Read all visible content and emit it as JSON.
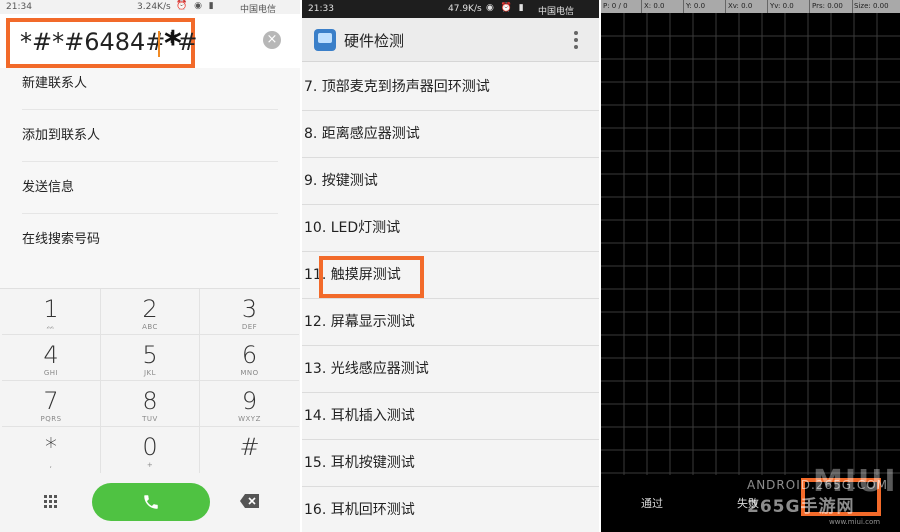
{
  "dialer": {
    "status": {
      "time": "21:34",
      "speed": "3.24K/s",
      "icons": "⏰ ◉ ▮",
      "carrier": "中国电信"
    },
    "number": "*#*#6484#*#",
    "star": "*",
    "menu": [
      "新建联系人",
      "添加到联系人",
      "发送信息",
      "在线搜索号码"
    ],
    "keys": [
      {
        "digit": "1",
        "letters": "ᨐ"
      },
      {
        "digit": "2",
        "letters": "ABC"
      },
      {
        "digit": "3",
        "letters": "DEF"
      },
      {
        "digit": "4",
        "letters": "GHI"
      },
      {
        "digit": "5",
        "letters": "JKL"
      },
      {
        "digit": "6",
        "letters": "MNO"
      },
      {
        "digit": "7",
        "letters": "PQRS"
      },
      {
        "digit": "8",
        "letters": "TUV"
      },
      {
        "digit": "9",
        "letters": "WXYZ"
      },
      {
        "digit": "*",
        "letters": ","
      },
      {
        "digit": "0",
        "letters": "+"
      },
      {
        "digit": "#",
        "letters": ""
      }
    ]
  },
  "hwtest": {
    "status": {
      "time": "21:33",
      "speed": "47.9K/s",
      "icons": "◉ ⏰ ▮",
      "carrier": "中国电信"
    },
    "title": "硬件检测",
    "items": [
      "7. 顶部麦克到扬声器回环测试",
      "8. 距离感应器测试",
      "9. 按键测试",
      "10. LED灯测试",
      "11. 触摸屏测试",
      "12. 屏幕显示测试",
      "13. 光线感应器测试",
      "14. 耳机插入测试",
      "15. 耳机按键测试",
      "16. 耳机回环测试"
    ]
  },
  "touchtest": {
    "fields": [
      "P: 0 / 0",
      "X: 0.0",
      "Y: 0.0",
      "Xv: 0.0",
      "Yv: 0.0",
      "Prs: 0.00",
      "Size: 0.00"
    ],
    "pass_label": "通过",
    "fail_label": "失败",
    "watermark": {
      "main": "ANDROID.265G.COM",
      "big": "MIUI",
      "mid": "265G手游网",
      "url": "www.miui.com"
    }
  }
}
